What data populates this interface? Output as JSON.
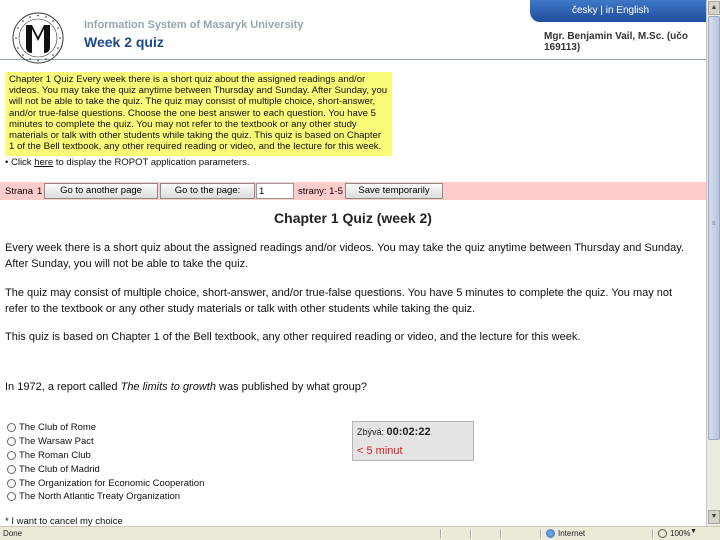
{
  "header": {
    "institution": "Information System of Masaryk University",
    "page_title": "Week 2 quiz",
    "lang_cz": "česky",
    "lang_sep": "|",
    "lang_en": "in English",
    "user": "Mgr. Benjamin Vail, M.Sc. (učo 169113)"
  },
  "info_box": {
    "text": "Chapter 1 Quiz Every week there is a short quiz about the assigned readings and/or videos. You may take the quiz anytime between Thursday and Sunday. After Sunday, you will not be able to take the quiz. The quiz may consist of multiple choice, short-answer, and/or true-false questions. Choose the one best answer to each question. You have 5 minutes to complete the quiz. You may not refer to the textbook or any other study materials or talk with other students while taking the quiz. This quiz is based on Chapter 1 of the Bell textbook, any other required reading or video, and the lecture for this week."
  },
  "roport": {
    "bullet": "•",
    "prefix": "Click",
    "link": "here",
    "suffix": "to display the ROPOT application parameters."
  },
  "nav": {
    "page_label": "Strana",
    "page_current": "1",
    "go_another_button": "Go to another page",
    "go_page_button": "Go to the page:",
    "page_input_value": "1",
    "pages_label": "strany: 1-5",
    "save_button": "Save temporarily"
  },
  "quiz": {
    "title": "Chapter 1 Quiz (week 2)",
    "para1": "Every week there is a short quiz about the assigned readings and/or videos. You may take the quiz anytime between Thursday and Sunday. After Sunday, you will not be able to take the quiz.",
    "para2": "The quiz may consist of multiple choice, short-answer, and/or true-false questions. You have 5 minutes to complete the quiz. You may not refer to the textbook or any other study materials or talk with other students while taking the quiz.",
    "para3": "This quiz is based on Chapter 1 of the Bell textbook, any other required reading or video, and the lecture for this week.",
    "question_prefix": "In 1972, a report called",
    "question_title": "The limits to growth",
    "question_suffix": "was published by what group?",
    "options": [
      "The Club of Rome",
      "The Warsaw Pact",
      "The Roman Club",
      "The Club of Madrid",
      "The Organization for Economic Cooperation",
      "The North Atlantic Treaty Organization"
    ],
    "cancel_text": "* I want to cancel my choice"
  },
  "timer": {
    "label": "Zbývá:",
    "value": "00:02:22",
    "note": "< 5 minut"
  },
  "statusbar": {
    "done": "Done",
    "zone": "Internet",
    "zoom": "100%"
  },
  "colors": {
    "info_box_bg": "#fbfb7a",
    "nav_bar_bg": "#ffcccc",
    "title_blue": "#1d4a8c",
    "timer_red": "#d42020"
  }
}
